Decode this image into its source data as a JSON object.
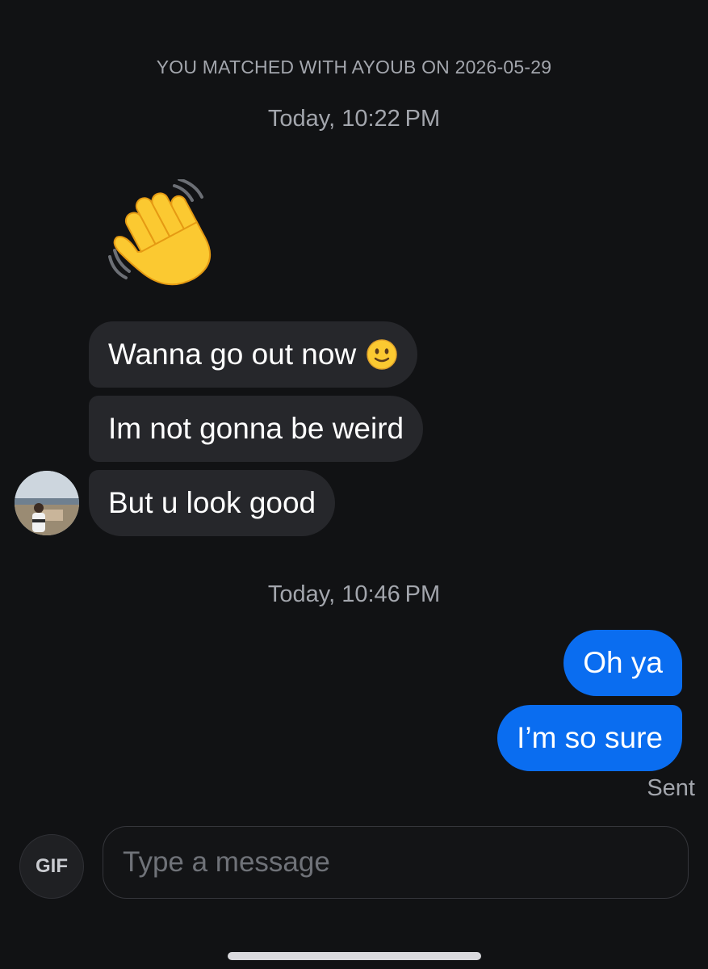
{
  "chat": {
    "match_banner": "YOU MATCHED WITH AYOUB ON 2026-05-29",
    "timestamps": [
      "Today, 10:22 PM",
      "Today, 10:46 PM"
    ],
    "received": [
      {
        "text": "Wanna go out now",
        "emoji": "slightly-smiling-face-icon"
      },
      {
        "text": "Im not gonna be weird"
      },
      {
        "text": "But u look good"
      }
    ],
    "sent": [
      {
        "text": "Oh ya"
      },
      {
        "text": "I’m so sure"
      }
    ],
    "sent_status": "Sent",
    "wave_emoji": "waving-hand-icon",
    "avatar_icon": "contact-avatar"
  },
  "composer": {
    "gif_label": "GIF",
    "input_placeholder": "Type a message",
    "input_value": ""
  },
  "colors": {
    "background": "#111214",
    "received_bubble": "#26272b",
    "sent_bubble": "#0a6df0",
    "muted_text": "#a3a6ad"
  }
}
